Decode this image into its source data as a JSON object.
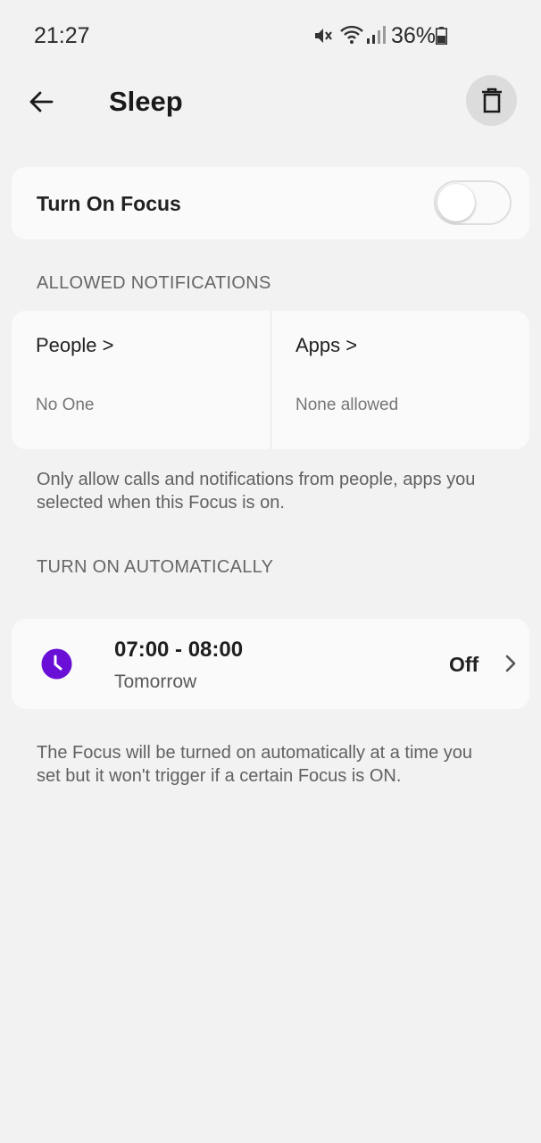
{
  "status_bar": {
    "time": "21:27",
    "battery": "36%",
    "icons": [
      "mute-icon",
      "wifi-icon",
      "signal-icon",
      "battery-icon"
    ]
  },
  "app_bar": {
    "title": "Sleep",
    "back_icon": "back-arrow-icon",
    "delete_icon": "trash-icon"
  },
  "focus": {
    "label": "Turn On Focus",
    "enabled": false
  },
  "allowed_notifications": {
    "header": "ALLOWED NOTIFICATIONS",
    "people": {
      "title": "People >",
      "value": "No One"
    },
    "apps": {
      "title": "Apps >",
      "value": "None allowed"
    },
    "description": "Only allow calls and notifications from people, apps you selected when this Focus is on."
  },
  "auto": {
    "header": "TURN ON AUTOMATICALLY",
    "schedule": {
      "time": "07:00 - 08:00",
      "day": "Tomorrow",
      "state": "Off",
      "icon": "clock-icon",
      "icon_color": "#6a0fd6"
    },
    "description": "The Focus will be turned on automatically at a time you set but it won't trigger if a certain Focus is ON."
  }
}
